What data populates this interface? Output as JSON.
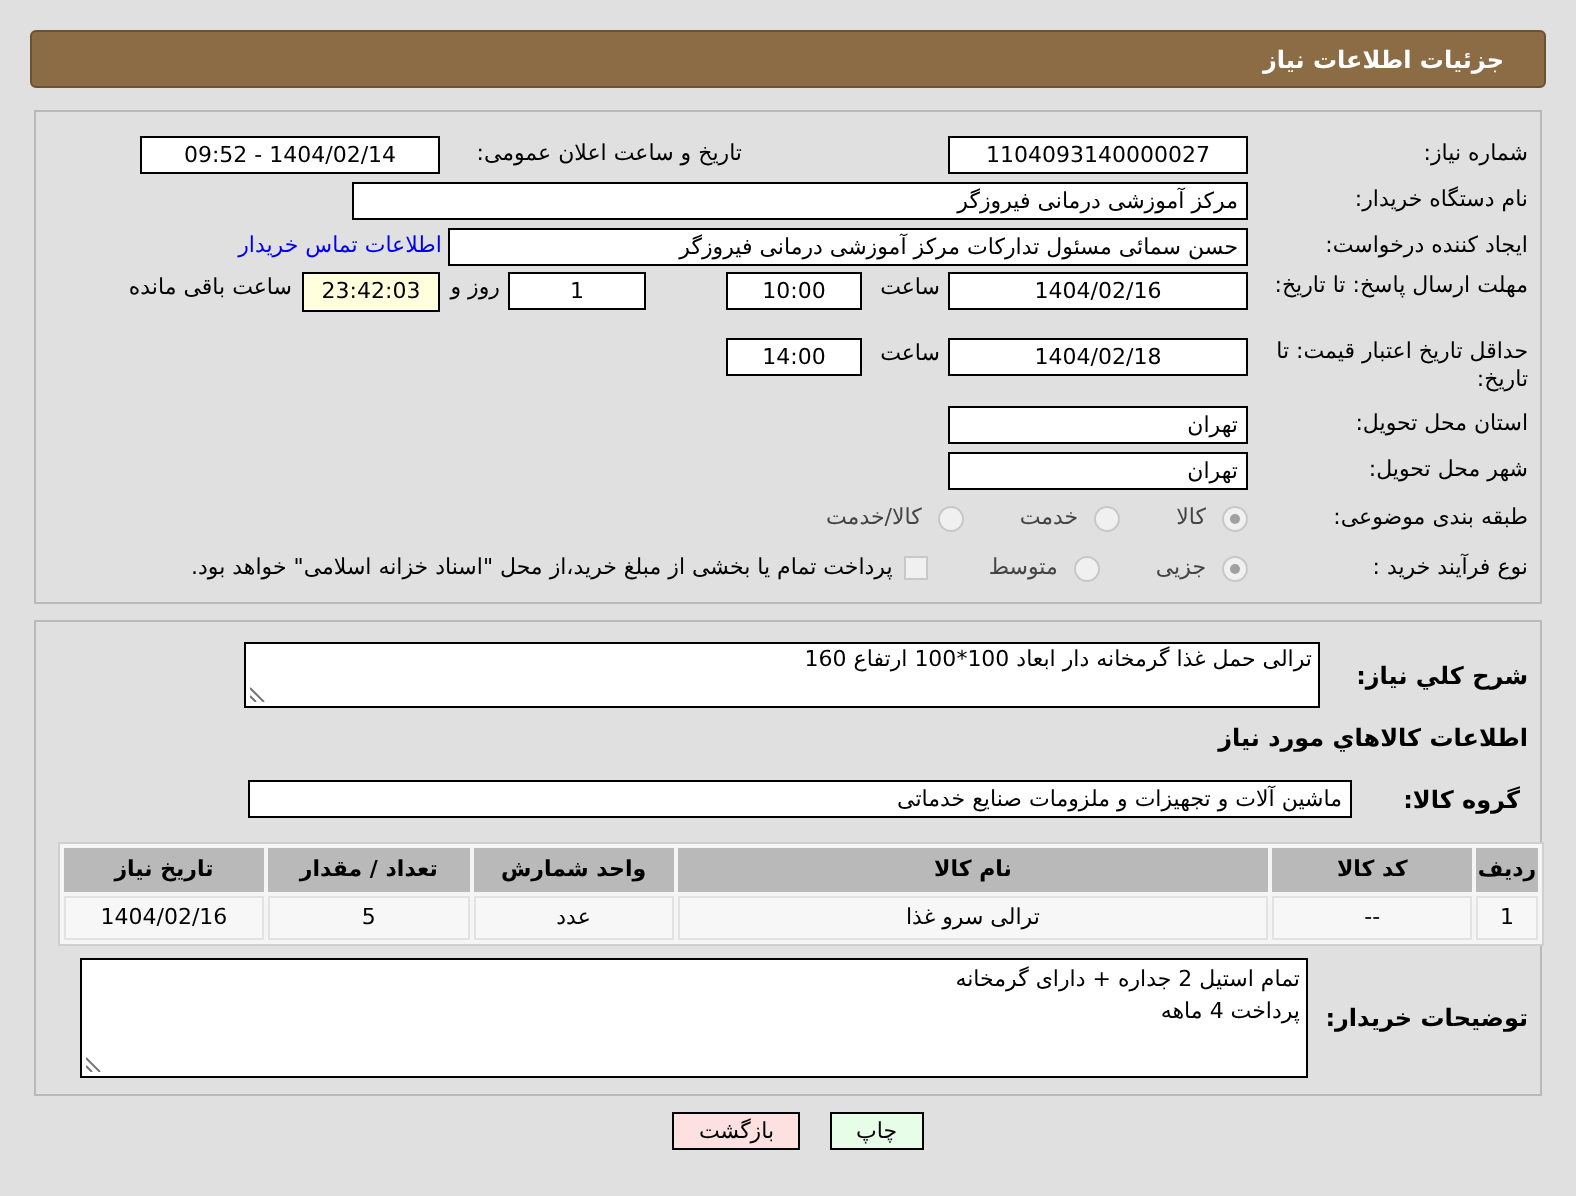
{
  "header": {
    "title": "جزئیات اطلاعات نیاز"
  },
  "need_number": {
    "label": "شماره نیاز:",
    "value": "1104093140000027"
  },
  "announce": {
    "label": "تاریخ و ساعت اعلان عمومی:",
    "value": "1404/02/14 - 09:52"
  },
  "buyer_org": {
    "label": "نام دستگاه خریدار:",
    "value": "مرکز آموزشی درمانی فیروزگر"
  },
  "creator": {
    "label": "ایجاد کننده درخواست:",
    "value": "حسن سمائی مسئول تدارکات مرکز آموزشی درمانی فیروزگر",
    "link": "اطلاعات تماس خریدار"
  },
  "deadline": {
    "label": "مهلت ارسال پاسخ: تا تاریخ:",
    "date": "1404/02/16",
    "time_label": "ساعت",
    "time": "10:00",
    "days": "1",
    "days_label": "روز و",
    "remaining": "23:42:03",
    "remaining_label": "ساعت باقی مانده"
  },
  "price_validity": {
    "label": "حداقل تاریخ اعتبار قیمت: تا تاریخ:",
    "date": "1404/02/18",
    "time_label": "ساعت",
    "time": "14:00"
  },
  "province": {
    "label": "استان محل تحویل:",
    "value": "تهران"
  },
  "city": {
    "label": "شهر محل تحویل:",
    "value": "تهران"
  },
  "category": {
    "label": "طبقه بندی موضوعی:",
    "options": [
      {
        "label": "کالا",
        "selected": true
      },
      {
        "label": "خدمت",
        "selected": false
      },
      {
        "label": "کالا/خدمت",
        "selected": false
      }
    ]
  },
  "process": {
    "label": "نوع فرآیند خرید :",
    "options": [
      {
        "label": "جزیی",
        "selected": true
      },
      {
        "label": "متوسط",
        "selected": false
      }
    ],
    "treasury": {
      "label": "پرداخت تمام یا بخشی از مبلغ خرید،از محل \"اسناد خزانه اسلامی\" خواهد بود.",
      "checked": false
    }
  },
  "description": {
    "label": "شرح کلي نياز:",
    "value": "ترالی حمل غذا گرمخانه دار ابعاد 100*100 ارتفاع 160"
  },
  "goods_heading": "اطلاعات کالاهاي مورد نياز",
  "goods_group": {
    "label": "گروه کالا:",
    "value": "ماشین آلات و تجهیزات و ملزومات صنایع خدماتی"
  },
  "table": {
    "columns": [
      "ردیف",
      "کد کالا",
      "نام کالا",
      "واحد شمارش",
      "تعداد / مقدار",
      "تاریخ نیاز"
    ],
    "rows": [
      [
        "1",
        "--",
        "ترالی سرو غذا",
        "عدد",
        "5",
        "1404/02/16"
      ]
    ]
  },
  "buyer_notes": {
    "label": "توضیحات خریدار:",
    "lines": [
      "تمام استیل 2 جداره + دارای گرمخانه",
      "پرداخت 4 ماهه"
    ]
  },
  "buttons": [
    {
      "label": "چاپ",
      "kind": "print"
    },
    {
      "label": "بازگشت",
      "kind": "back"
    }
  ]
}
